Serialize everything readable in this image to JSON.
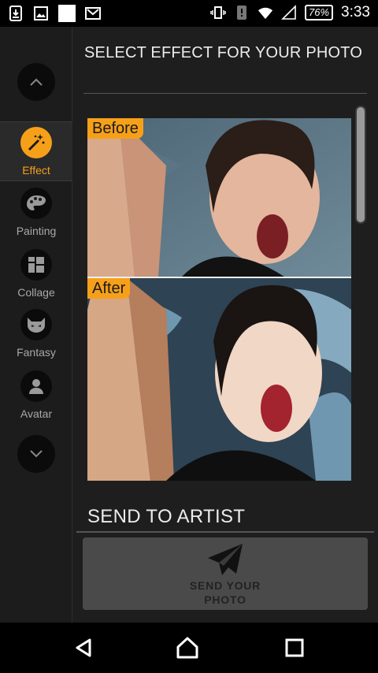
{
  "status_bar": {
    "battery": "76%",
    "time": "3:33",
    "left_icons": [
      "download-notification-icon",
      "image-notification-icon",
      "white-square-icon",
      "mail-icon"
    ],
    "right_icons": [
      "vibrate-icon",
      "alert-icon",
      "wifi-icon",
      "signal-icon"
    ]
  },
  "sidebar": {
    "items": [
      {
        "label": "Effect",
        "icon": "magic-wand-icon",
        "active": true
      },
      {
        "label": "Painting",
        "icon": "palette-icon",
        "active": false
      },
      {
        "label": "Collage",
        "icon": "collage-icon",
        "active": false
      },
      {
        "label": "Fantasy",
        "icon": "mask-icon",
        "active": false
      },
      {
        "label": "Avatar",
        "icon": "person-icon",
        "active": false
      }
    ]
  },
  "main": {
    "title": "SELECT EFFECT FOR YOUR PHOTO",
    "before_label": "Before",
    "after_label": "After",
    "send_section_title": "SEND TO ARTIST",
    "send_button_label": "SEND YOUR PHOTO"
  },
  "colors": {
    "accent": "#f6a01a",
    "background": "#1e1e1f",
    "button": "#4a4a4a"
  }
}
